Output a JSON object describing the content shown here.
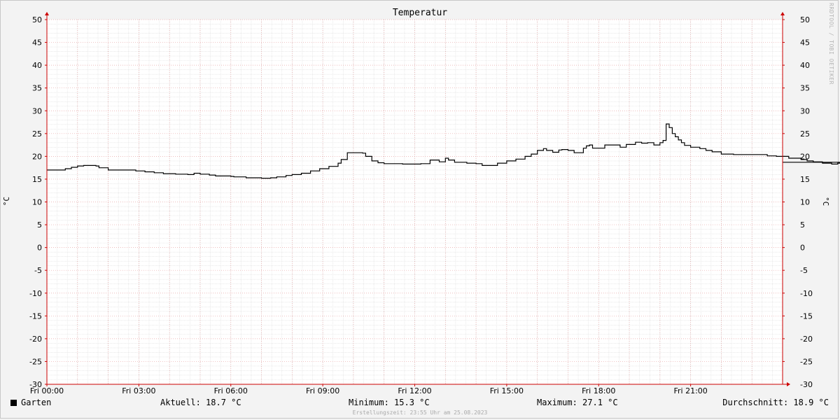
{
  "chart_data": {
    "type": "line",
    "title": "Temperatur",
    "ylabel": "°C",
    "ylim": [
      -30,
      50
    ],
    "y_ticks": [
      50,
      45,
      40,
      35,
      30,
      25,
      20,
      15,
      10,
      5,
      0,
      -5,
      -10,
      -15,
      -20,
      -25,
      -30
    ],
    "x_tick_labels": [
      "Fri 00:00",
      "Fri 03:00",
      "Fri 06:00",
      "Fri 09:00",
      "Fri 12:00",
      "Fri 15:00",
      "Fri 18:00",
      "Fri 21:00"
    ],
    "x_tick_hours": [
      0,
      3,
      6,
      9,
      12,
      15,
      18,
      21
    ],
    "xlim_hours": [
      0,
      24
    ],
    "grid": true,
    "legend_position": "bottom-left",
    "series": [
      {
        "name": "Garten",
        "color": "#000000",
        "points": [
          [
            0.0,
            17.0
          ],
          [
            0.4,
            17.0
          ],
          [
            0.6,
            17.3
          ],
          [
            0.8,
            17.6
          ],
          [
            1.0,
            17.9
          ],
          [
            1.2,
            18.0
          ],
          [
            1.5,
            18.0
          ],
          [
            1.6,
            17.9
          ],
          [
            1.7,
            17.5
          ],
          [
            1.9,
            17.5
          ],
          [
            2.0,
            17.0
          ],
          [
            2.8,
            17.0
          ],
          [
            2.9,
            16.8
          ],
          [
            3.2,
            16.6
          ],
          [
            3.5,
            16.4
          ],
          [
            3.8,
            16.2
          ],
          [
            4.2,
            16.1
          ],
          [
            4.6,
            16.0
          ],
          [
            4.8,
            16.3
          ],
          [
            5.0,
            16.1
          ],
          [
            5.3,
            15.9
          ],
          [
            5.5,
            15.7
          ],
          [
            6.0,
            15.6
          ],
          [
            6.1,
            15.5
          ],
          [
            6.5,
            15.3
          ],
          [
            7.0,
            15.2
          ],
          [
            7.3,
            15.3
          ],
          [
            7.5,
            15.5
          ],
          [
            7.8,
            15.8
          ],
          [
            8.0,
            16.0
          ],
          [
            8.3,
            16.3
          ],
          [
            8.6,
            16.8
          ],
          [
            8.9,
            17.3
          ],
          [
            9.2,
            17.8
          ],
          [
            9.5,
            18.5
          ],
          [
            9.6,
            19.3
          ],
          [
            9.8,
            20.8
          ],
          [
            10.0,
            20.8
          ],
          [
            10.3,
            20.7
          ],
          [
            10.4,
            20.0
          ],
          [
            10.6,
            19.0
          ],
          [
            10.8,
            18.6
          ],
          [
            11.0,
            18.4
          ],
          [
            11.3,
            18.4
          ],
          [
            11.6,
            18.3
          ],
          [
            11.8,
            18.3
          ],
          [
            12.2,
            18.4
          ],
          [
            12.5,
            19.2
          ],
          [
            12.8,
            18.8
          ],
          [
            13.0,
            19.6
          ],
          [
            13.1,
            19.2
          ],
          [
            13.3,
            18.7
          ],
          [
            13.7,
            18.5
          ],
          [
            14.0,
            18.4
          ],
          [
            14.2,
            18.0
          ],
          [
            14.5,
            18.0
          ],
          [
            14.7,
            18.5
          ],
          [
            15.0,
            19.0
          ],
          [
            15.3,
            19.4
          ],
          [
            15.6,
            20.0
          ],
          [
            15.8,
            20.5
          ],
          [
            16.0,
            21.3
          ],
          [
            16.2,
            21.7
          ],
          [
            16.3,
            21.3
          ],
          [
            16.5,
            20.9
          ],
          [
            16.7,
            21.4
          ],
          [
            16.8,
            21.5
          ],
          [
            17.0,
            21.3
          ],
          [
            17.2,
            20.8
          ],
          [
            17.5,
            21.8
          ],
          [
            17.6,
            22.3
          ],
          [
            17.7,
            22.5
          ],
          [
            17.8,
            21.8
          ],
          [
            18.0,
            21.8
          ],
          [
            18.2,
            22.5
          ],
          [
            18.5,
            22.5
          ],
          [
            18.7,
            22.0
          ],
          [
            18.9,
            22.6
          ],
          [
            19.2,
            23.1
          ],
          [
            19.4,
            22.9
          ],
          [
            19.6,
            23.0
          ],
          [
            19.8,
            22.5
          ],
          [
            20.0,
            23.0
          ],
          [
            20.1,
            23.5
          ],
          [
            20.2,
            27.1
          ],
          [
            20.3,
            26.3
          ],
          [
            20.4,
            25.0
          ],
          [
            20.5,
            24.3
          ],
          [
            20.6,
            23.6
          ],
          [
            20.7,
            23.0
          ],
          [
            20.8,
            22.4
          ],
          [
            21.0,
            22.0
          ],
          [
            21.3,
            21.7
          ],
          [
            21.5,
            21.3
          ],
          [
            21.7,
            21.0
          ],
          [
            22.0,
            20.5
          ],
          [
            22.4,
            20.4
          ],
          [
            22.8,
            20.4
          ],
          [
            23.2,
            20.4
          ],
          [
            23.5,
            20.1
          ],
          [
            23.8,
            20.0
          ],
          [
            24.2,
            19.6
          ],
          [
            24.6,
            19.3
          ],
          [
            24.8,
            19.0
          ],
          [
            25.0,
            18.8
          ],
          [
            25.3,
            18.5
          ],
          [
            25.6,
            18.3
          ],
          [
            25.8,
            18.5
          ],
          [
            26.0,
            18.2
          ],
          [
            26.3,
            17.9
          ],
          [
            26.5,
            17.6
          ],
          [
            26.7,
            17.8
          ],
          [
            26.8,
            18.2
          ],
          [
            27.0,
            18.5
          ],
          [
            27.3,
            18.7
          ]
        ]
      }
    ]
  },
  "watermark": "RRDTOOL / TOBI OETIKER",
  "legend": {
    "series_name": "Garten",
    "current": "Aktuell: 18.7 °C",
    "minimum": "Minimum: 15.3 °C",
    "maximum": "Maximum: 27.1 °C",
    "average": "Durchschnitt: 18.9 °C"
  },
  "footer": "Erstellungszeit: 23:55 Uhr am 25.08.2023"
}
